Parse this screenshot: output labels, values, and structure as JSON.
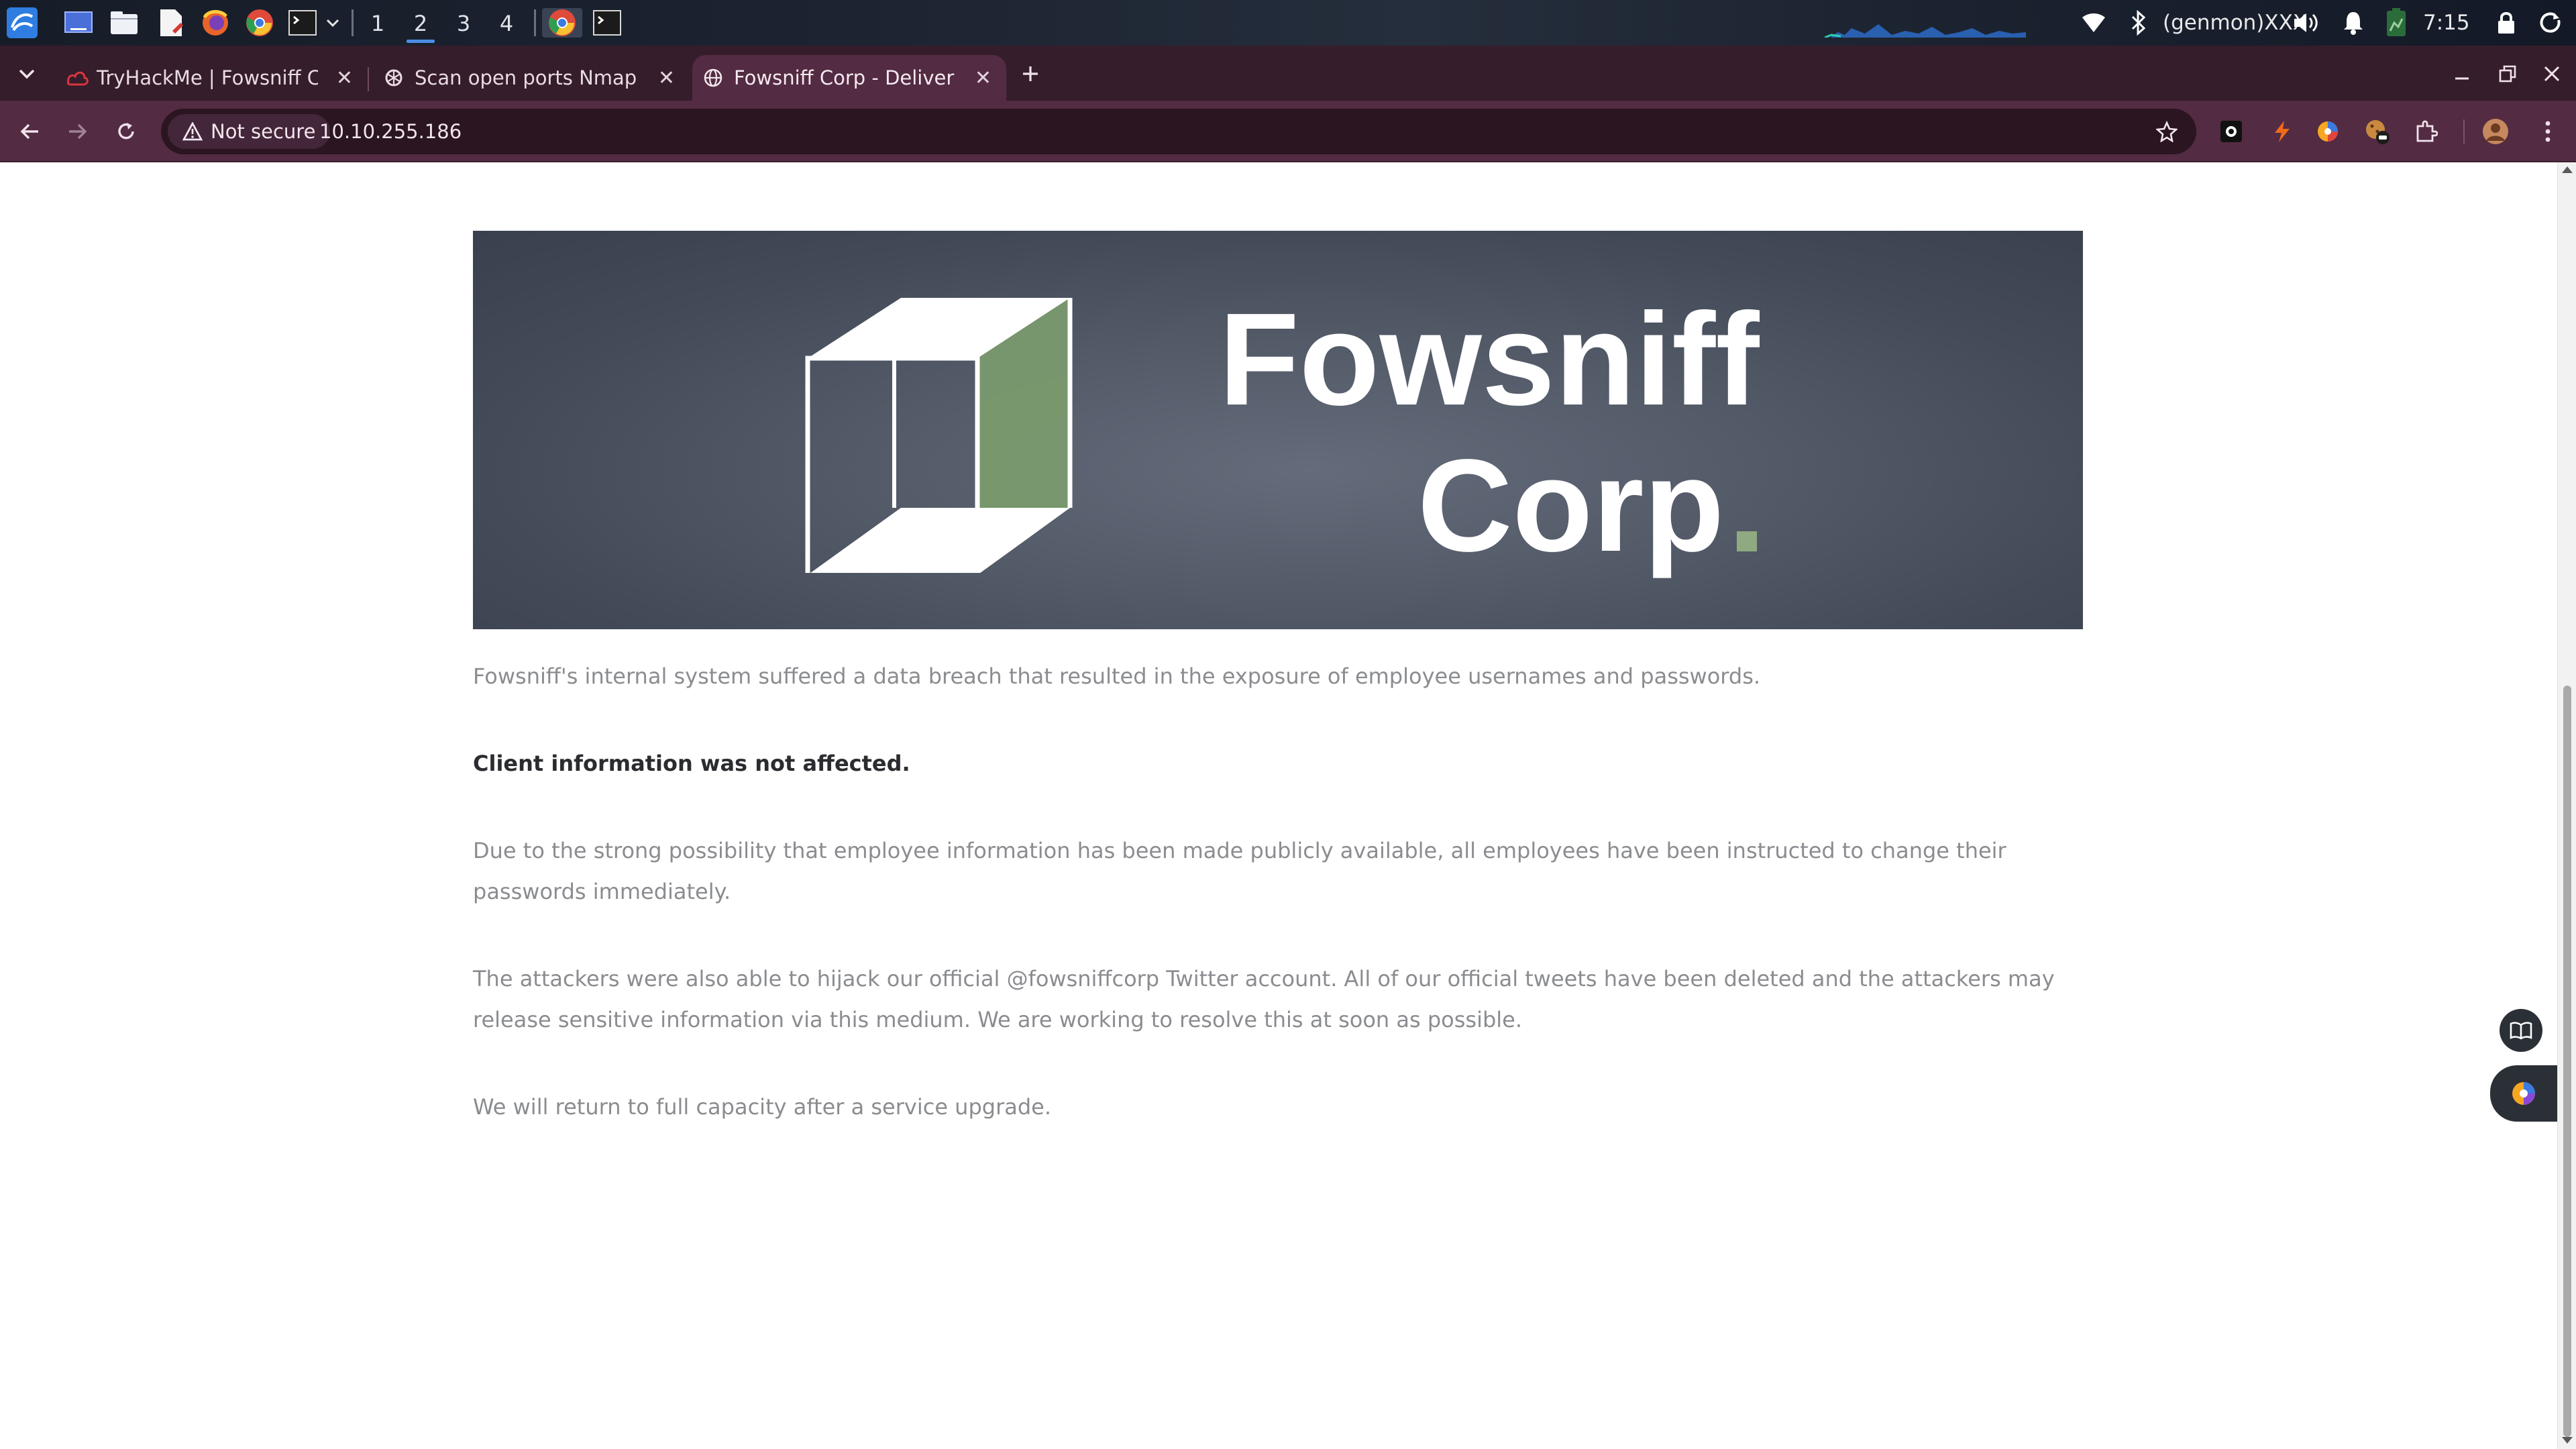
{
  "taskbar": {
    "workspaces": [
      "1",
      "2",
      "3",
      "4"
    ],
    "active_workspace": "2",
    "genmon": "(genmon)XXX",
    "clock": "7:15"
  },
  "browser": {
    "tabs": [
      {
        "title": "TryHackMe | Fowsniff CT",
        "icon": "tryhackme-icon",
        "active": false
      },
      {
        "title": "Scan open ports Nmap",
        "icon": "chatgpt-icon",
        "active": false
      },
      {
        "title": "Fowsniff Corp - Deliverin",
        "icon": "globe-icon",
        "active": true
      }
    ],
    "security_label": "Not secure",
    "url": "10.10.255.186"
  },
  "page": {
    "banner": {
      "line1": "Fowsniff",
      "line2": "Corp"
    },
    "paragraphs": [
      "Fowsniff's internal system suffered a data breach that resulted in the exposure of employee usernames and passwords.",
      "Client information was not affected.",
      "Due to the strong possibility that employee information has been made publicly available, all employees have been instructed to change their passwords immediately.",
      "The attackers were also able to hijack our official @fowsniffcorp Twitter account. All of our official tweets have been deleted and the attackers may release sensitive information via this medium. We are working to resolve this at soon as possible.",
      "We will return to full capacity after a service upgrade."
    ]
  },
  "colors": {
    "accent_green": "#7a9a6e",
    "tab_strip": "#361d2c",
    "toolbar": "#532b42"
  }
}
